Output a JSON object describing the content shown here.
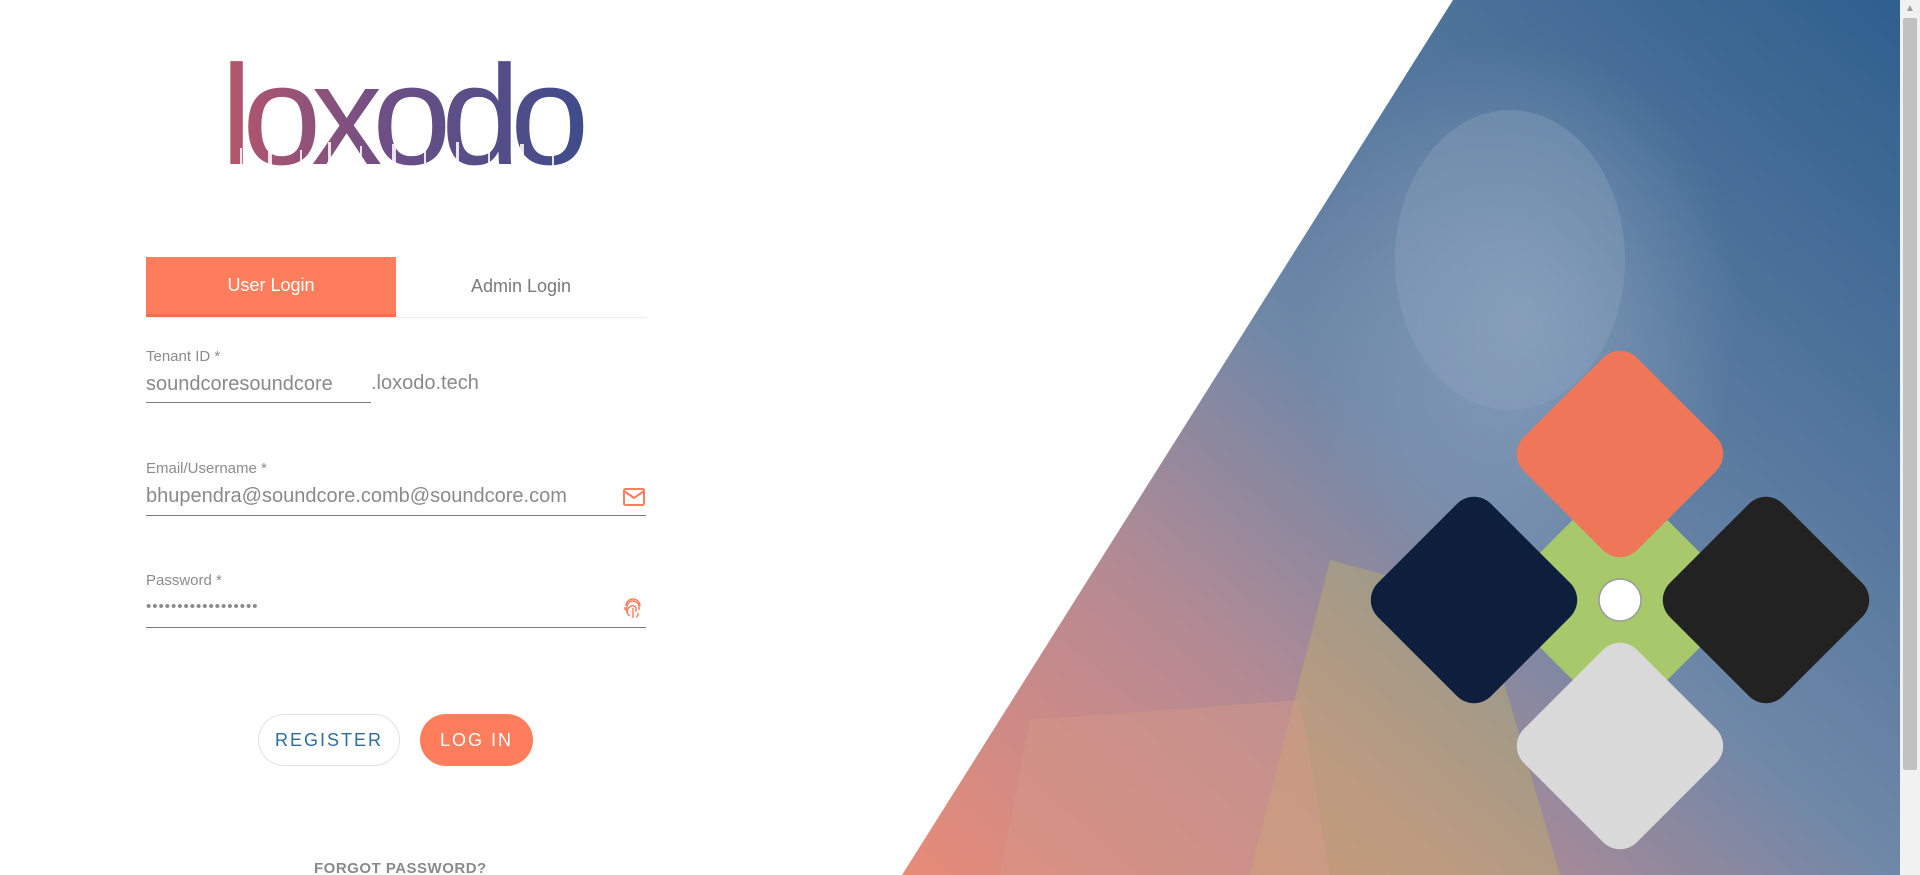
{
  "brand": {
    "logo_text": "loxodo"
  },
  "tabs": [
    {
      "label": "User Login",
      "active": true
    },
    {
      "label": "Admin Login",
      "active": false
    }
  ],
  "form": {
    "tenant": {
      "label": "Tenant ID *",
      "value": "soundcoresoundcore",
      "suffix": ".loxodo.tech"
    },
    "email": {
      "label": "Email/Username *",
      "value": "bhupendra@soundcore.comb@soundcore.com",
      "icon": "mail-icon"
    },
    "password": {
      "label": "Password *",
      "value": "••••••••••••••••••",
      "icon": "fingerprint-icon"
    }
  },
  "buttons": {
    "register": "REGISTER",
    "login": "LOG IN"
  },
  "forgot_password": "FORGOT PASSWORD?",
  "colors": {
    "accent": "#fd7d5c",
    "link_blue": "#2e6d9e",
    "hero_blue": "#3f6b96",
    "tile_orange": "#f0765a",
    "tile_navy": "#0d1f3d",
    "tile_black": "#222222",
    "tile_grey": "#d9d9d9",
    "tile_green": "#a7c96b"
  }
}
